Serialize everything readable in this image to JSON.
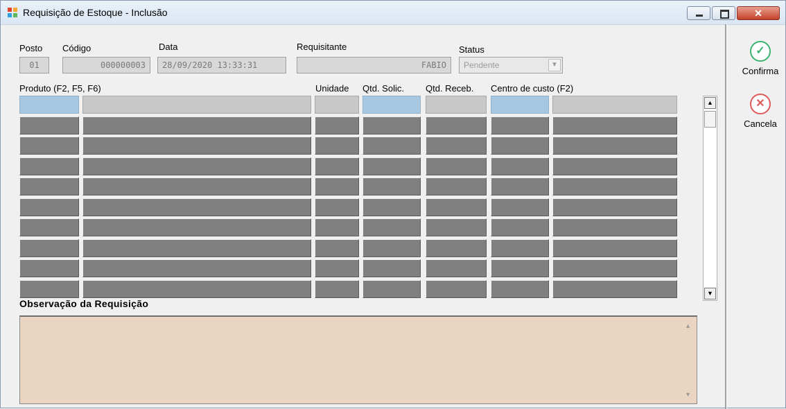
{
  "window": {
    "title": "Requisição de Estoque - Inclusão",
    "icon": "app-colored-squares-icon",
    "controls": {
      "minimize": "minimize-icon",
      "maximize": "maximize-icon",
      "close": "✕"
    }
  },
  "header": {
    "posto": {
      "label": "Posto",
      "value": "01"
    },
    "codigo": {
      "label": "Código",
      "value": "000000003"
    },
    "data": {
      "label": "Data",
      "value": "28/09/2020 13:33:31"
    },
    "requisitante": {
      "label": "Requisitante",
      "value": "FABIO"
    },
    "status": {
      "label": "Status",
      "value": "Pendente"
    }
  },
  "grid": {
    "columns": [
      "Produto (F2, F5, F6)",
      "Unidade",
      "Qtd. Solic.",
      "Qtd. Receb.",
      "Centro de custo (F2)"
    ],
    "row_count": 10
  },
  "observacao": {
    "label": "Observação da Requisição",
    "value": ""
  },
  "actions": {
    "confirm": {
      "label": "Confirma",
      "icon": "checkmark-circle-icon",
      "color": "#3cb371"
    },
    "cancel": {
      "label": "Cancela",
      "icon": "x-circle-icon",
      "color": "#e05a5a"
    }
  }
}
